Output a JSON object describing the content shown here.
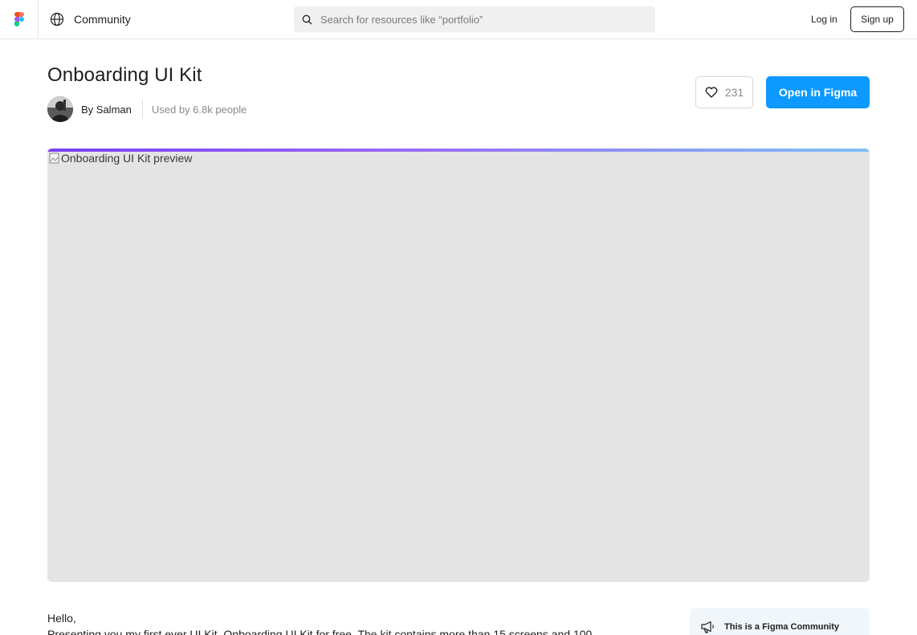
{
  "header": {
    "community_label": "Community",
    "search_placeholder": "Search for resources like “portfolio”",
    "login_label": "Log in",
    "signup_label": "Sign up"
  },
  "resource": {
    "title": "Onboarding UI Kit",
    "author": "By Salman",
    "usage": "Used by 6.8k people",
    "likes": "231",
    "open_label": "Open in Figma",
    "preview_alt": "Onboarding UI Kit preview"
  },
  "description": {
    "line1": "Hello,",
    "line2": "Presenting you my first ever UI Kit, Onboarding UI Kit for free. The kit contains more than 15 screens and 100"
  },
  "notice": {
    "text": "This is a Figma Community"
  },
  "colors": {
    "accent": "#0d99ff",
    "preview_bg": "#e4e4e4",
    "gradient_start": "#7b3ff2",
    "gradient_end": "#7ec0f7"
  }
}
